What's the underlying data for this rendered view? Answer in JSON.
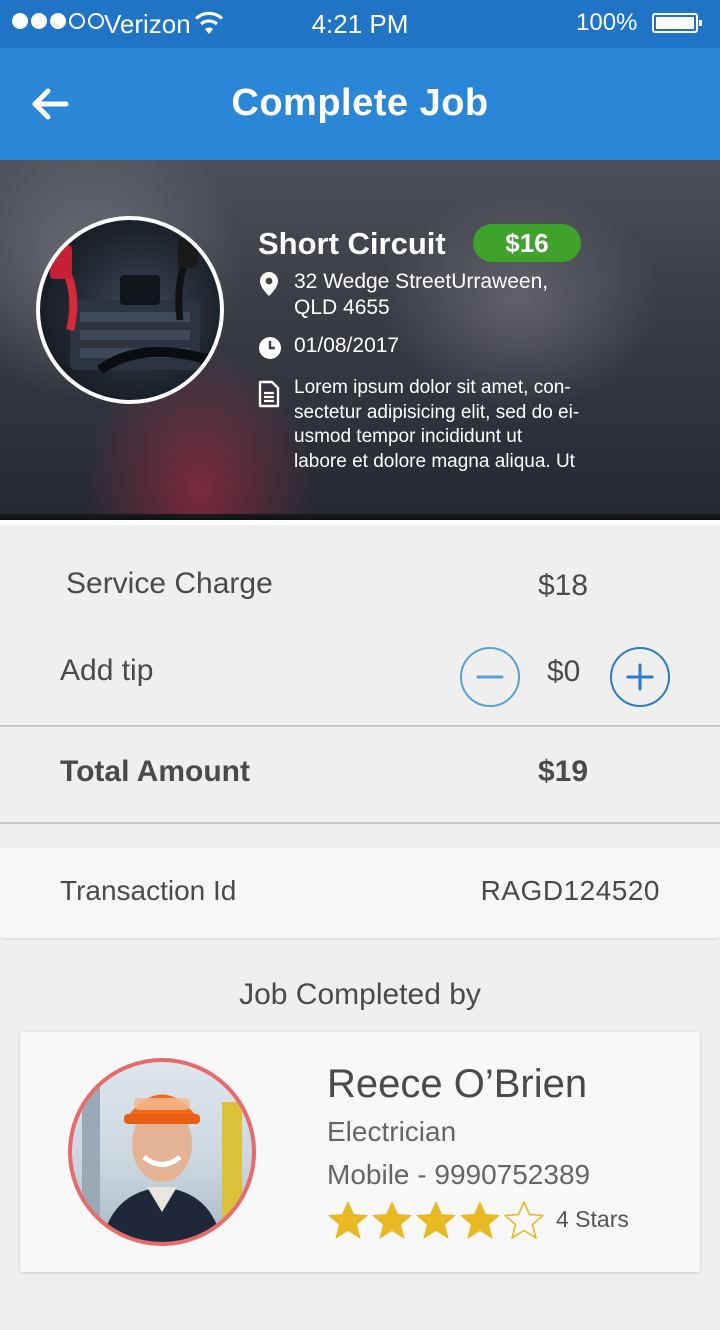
{
  "status_bar": {
    "carrier": "Verizon",
    "time": "4:21 PM",
    "battery": "100%"
  },
  "header": {
    "title": "Complete Job"
  },
  "job": {
    "title": "Short Circuit",
    "price": "$16",
    "address_line1": "32 Wedge StreetUrraween,",
    "address_line2": "QLD 4655",
    "date": "01/08/2017",
    "description": [
      "Lorem ipsum dolor sit amet, con-",
      "sectetur adipisicing elit, sed do ei-",
      "usmod tempor incididunt ut",
      "labore et dolore magna aliqua. Ut"
    ]
  },
  "charges": {
    "service_label": "Service Charge",
    "service_value": "$18",
    "tip_label": "Add tip",
    "tip_value": "$0",
    "total_label": "Total Amount",
    "total_value": "$19"
  },
  "transaction": {
    "label": "Transaction Id",
    "value": "RAGD124520"
  },
  "worker": {
    "section_title": "Job Completed by",
    "name": "Reece O’Brien",
    "role": "Electrician",
    "mobile": "Mobile - 9990752389",
    "rating": 4,
    "rating_max": 5,
    "rating_label": "4 Stars",
    "star_color": "#e8b923"
  },
  "colors": {
    "status_bar": "#1f74c6",
    "app_bar": "#2a87d8",
    "price_badge": "#3fa22c",
    "avatar_ring": "#e86a6a"
  }
}
